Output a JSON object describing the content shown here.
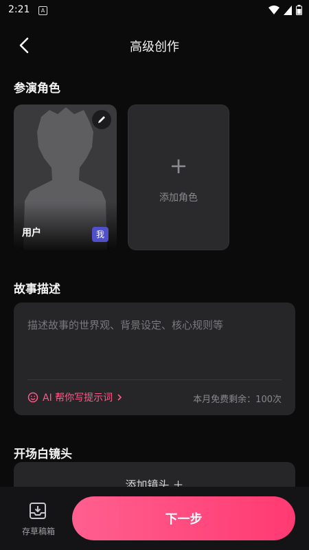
{
  "status": {
    "time": "2:21",
    "notif_letter": "A"
  },
  "header": {
    "title": "高级创作"
  },
  "cast": {
    "title": "参演角色",
    "user": {
      "name": "用户",
      "badge": "我"
    },
    "add_label": "添加角色",
    "add_plus": "+"
  },
  "story": {
    "title": "故事描述",
    "placeholder": "描述故事的世界观、背景设定、核心规则等",
    "ai_help": "AI 帮你写提示词",
    "quota": "本月免费剩余：100次"
  },
  "opening": {
    "title": "开场白镜头",
    "add_label": "添加镜头 ＋"
  },
  "footer": {
    "drafts_label": "存草稿箱",
    "next_label": "下一步"
  },
  "colors": {
    "accent": "#ff4a7d",
    "badge": "#5050c8",
    "background": "#0b0b0c"
  }
}
